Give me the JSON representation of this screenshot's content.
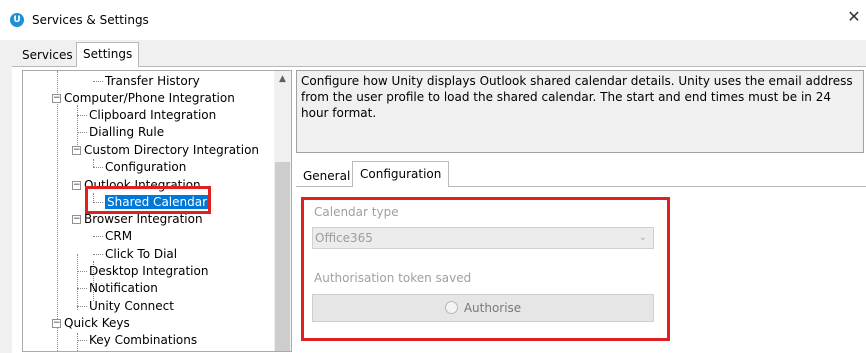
{
  "window": {
    "icon_letter": "U",
    "title": "Services & Settings",
    "close_glyph": "✕"
  },
  "tabs": [
    {
      "label": "Services"
    },
    {
      "label": "Settings",
      "active": true
    }
  ],
  "tree": {
    "items": [
      {
        "label": "Transfer History"
      },
      {
        "label": "Computer/Phone Integration",
        "expander": "−"
      },
      {
        "label": "Clipboard Integration"
      },
      {
        "label": "Dialling Rule"
      },
      {
        "label": "Custom Directory Integration",
        "expander": "−"
      },
      {
        "label": "Configuration"
      },
      {
        "label": "Outlook Integration",
        "expander": "−"
      },
      {
        "label": "Shared Calendar",
        "selected": true
      },
      {
        "label": "Browser Integration",
        "expander": "−"
      },
      {
        "label": "CRM"
      },
      {
        "label": "Click To Dial"
      },
      {
        "label": "Desktop Integration"
      },
      {
        "label": "Notification"
      },
      {
        "label": "Unity Connect"
      },
      {
        "label": "Quick Keys",
        "expander": "−"
      },
      {
        "label": "Key Combinations"
      }
    ],
    "scroll_up_glyph": "▲"
  },
  "description": "Configure how Unity displays Outlook shared calendar details.  Unity uses the email address from the user profile to load the shared calendar.  The start and end times must be in 24 hour format.",
  "config_tabs": [
    {
      "label": "General"
    },
    {
      "label": "Configuration",
      "active": true
    }
  ],
  "config": {
    "calendar_type_label": "Calendar type",
    "calendar_type_value": "Office365",
    "dropdown_glyph": "⌄",
    "token_label": "Authorisation token saved",
    "authorise_label": "Authorise"
  },
  "colors": {
    "accent": "#0078d7",
    "highlight_box": "#e02020",
    "app_icon": "#1e90d6"
  }
}
